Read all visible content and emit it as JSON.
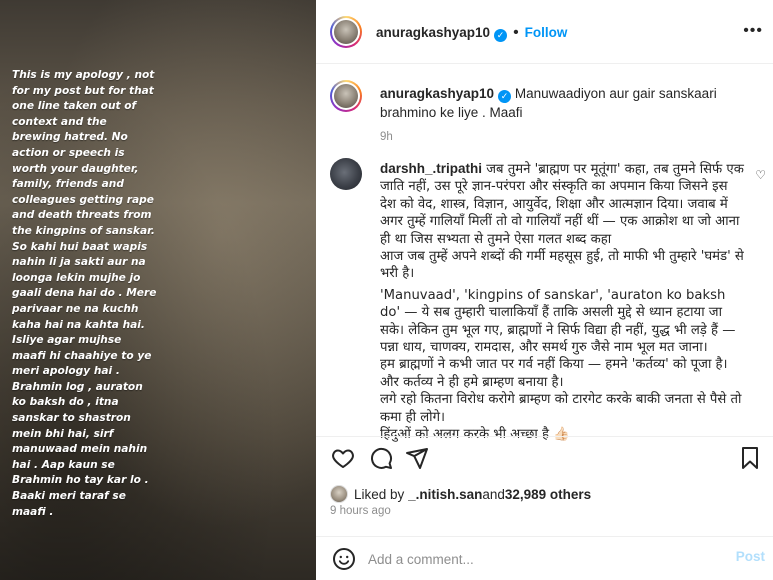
{
  "story": {
    "text": "This is my apology , not\nfor my post but for that\none line taken out of\ncontext and the\nbrewing hatred. No\naction or speech is\nworth your daughter,\nfamily, friends and\ncolleagues getting rape\nand death threats from\nthe kingpins of sanskar.\nSo kahi hui baat wapis\nnahin li ja sakti aur na\nloonga lekin mujhe jo\ngaali dena hai do . Mere\nparivaar ne na kuchh\nkaha hai na kahta hai.\nIsliye agar mujhse\nmaafi hi chaahiye to ye\nmeri apology hai .\nBrahmin log , auraton\nko baksh do , itna\nsanskar to shastron\nmein bhi hai, sirf\nmanuwaad mein nahin\nhai . Aap kaun se\nBrahmin ho tay kar lo .\nBaaki meri taraf se\nmaafi ."
  },
  "header": {
    "username": "anuragkashyap10",
    "separator": "•",
    "follow_label": "Follow",
    "more_label": "•••"
  },
  "caption": {
    "username": "anuragkashyap10",
    "text": "Manuwaadiyon aur gair sanskaari brahmino ke liye . Maafi",
    "time": "9h"
  },
  "comment": {
    "username": "darshh_.tripathi",
    "p1": "जब तुमने 'ब्राह्मण पर मूतूंगा' कहा, तब तुमने सिर्फ एक जाति नहीं, उस पूरे ज्ञान-परंपरा और संस्कृति का अपमान किया जिसने इस देश को वेद, शास्त्र, विज्ञान, आयुर्वेद, शिक्षा और आत्मज्ञान दिया। जवाब में अगर तुम्हें गालियाँ मिलीं तो वो गालियाँ नहीं थीं — एक आक्रोश था जो आना ही था जिस सभ्यता से तुमने ऐसा गलत शब्द कहा",
    "p2": "आज जब तुम्हें अपने शब्दों की गर्मी महसूस हुई, तो माफी भी तुम्हारे 'घमंड' से भरी है।",
    "p3": "'Manuvaad', 'kingpins of sanskar', 'auraton ko baksh do' — ये सब तुम्हारी चालाकियाँ हैं ताकि असली मुद्दे से ध्यान हटाया जा सके। लेकिन तुम भूल गए, ब्राह्मणों ने सिर्फ विद्या ही नहीं, युद्ध भी लड़े हैं — पन्ना धाय, चाणक्य, रामदास, और समर्थ गुरु जैसे नाम भूल मत जाना।",
    "p4": "हम ब्राह्मणों ने कभी जात पर गर्व नहीं किया — हमने 'कर्तव्य' को पूजा है। और कर्तव्य ने ही हमे ब्राम्हण बनाया है।",
    "p5": "लगे रहो कितना विरोध करोगे ब्राम्हण को टारगेट करके बाकी जनता से पैसे तो कमा ही लोगे।",
    "p6": "हिंदुओं को अलग करके भी अच्छा है",
    "p6_emoji": "👍🏻"
  },
  "likes": {
    "prefix": "Liked by ",
    "user": "_.nitish.san",
    "middle": " and ",
    "count": "32,989 others"
  },
  "time_ago": "9 hours ago",
  "add_comment": {
    "placeholder": "Add a comment...",
    "post_label": "Post"
  },
  "colors": {
    "accent": "#0095f6",
    "post_disabled": "#b2dffc",
    "muted": "#8e8e8e"
  }
}
